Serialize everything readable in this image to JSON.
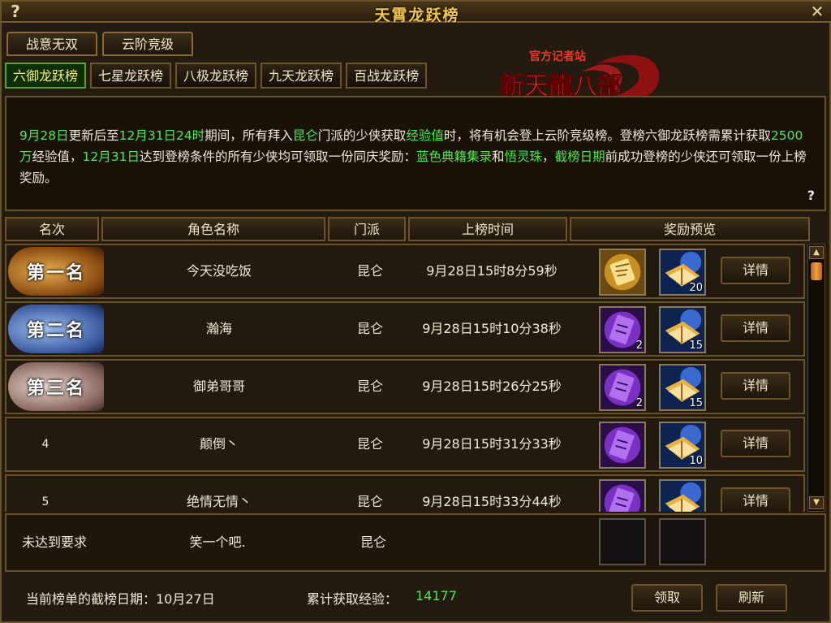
{
  "window": {
    "title": "天霄龙跃榜",
    "help_icon": "?",
    "close_icon": "✕"
  },
  "top_tabs": [
    {
      "label": "战意无双"
    },
    {
      "label": "云阶竞级"
    }
  ],
  "rank_tabs": [
    {
      "label": "六御龙跃榜",
      "active": true
    },
    {
      "label": "七星龙跃榜"
    },
    {
      "label": "八极龙跃榜"
    },
    {
      "label": "九天龙跃榜"
    },
    {
      "label": "百战龙跃榜"
    }
  ],
  "logo": {
    "lines": [
      "官方记者站",
      "新天龍八部"
    ]
  },
  "description": {
    "parts": [
      {
        "t": "9月28日",
        "g": true
      },
      {
        "t": "更新后至",
        "g": false
      },
      {
        "t": "12月31日24时",
        "g": true
      },
      {
        "t": "期间，所有拜入",
        "g": false
      },
      {
        "t": "昆仑",
        "g": true
      },
      {
        "t": "门派的少侠获取",
        "g": false
      },
      {
        "t": "经验值",
        "g": true
      },
      {
        "t": "时，将有机会登上云阶竞级榜。登榜六御龙跃榜需累计获取",
        "g": false
      },
      {
        "t": "2500万",
        "g": true
      },
      {
        "t": "经验值，",
        "g": false
      },
      {
        "t": "12月31日",
        "g": true
      },
      {
        "t": "达到登榜条件的所有少侠均可领取一份同庆奖励：",
        "g": false
      },
      {
        "t": "蓝色典籍集录",
        "g": true
      },
      {
        "t": "和",
        "g": false
      },
      {
        "t": "悟灵珠",
        "g": true
      },
      {
        "t": "，",
        "g": false
      },
      {
        "t": "截榜日期",
        "g": true
      },
      {
        "t": "前成功登榜的少侠还可领取一份上榜奖励。",
        "g": false
      }
    ]
  },
  "table": {
    "headers": [
      "名次",
      "角色名称",
      "门派",
      "上榜时间",
      "奖励预览"
    ],
    "detail_label": "详情",
    "rows": [
      {
        "rank": "第一名",
        "rank_style": "gold",
        "name": "今天没吃饭",
        "school": "昆仑",
        "time": "9月28日15时8分59秒",
        "reward1": {
          "icon": "gold-scroll-icon",
          "count": ""
        },
        "reward2": {
          "icon": "book-icon",
          "count": "20"
        }
      },
      {
        "rank": "第二名",
        "rank_style": "blue",
        "name": "瀚海",
        "school": "昆仑",
        "time": "9月28日15时10分38秒",
        "reward1": {
          "icon": "purple-scroll-icon",
          "count": "2"
        },
        "reward2": {
          "icon": "book-icon",
          "count": "15"
        }
      },
      {
        "rank": "第三名",
        "rank_style": "silver",
        "name": "御弟哥哥",
        "school": "昆仑",
        "time": "9月28日15时26分25秒",
        "reward1": {
          "icon": "purple-scroll-icon",
          "count": "2"
        },
        "reward2": {
          "icon": "book-icon",
          "count": "15"
        }
      },
      {
        "rank": "4",
        "rank_style": "plain",
        "name": "颠倒丶",
        "school": "昆仑",
        "time": "9月28日15时31分33秒",
        "reward1": {
          "icon": "purple-scroll-icon",
          "count": ""
        },
        "reward2": {
          "icon": "book-icon",
          "count": "10"
        }
      },
      {
        "rank": "5",
        "rank_style": "plain",
        "name": "绝情无情丶",
        "school": "昆仑",
        "time": "9月28日15时33分44秒",
        "reward1": {
          "icon": "purple-scroll-icon",
          "count": ""
        },
        "reward2": {
          "icon": "book-icon",
          "count": ""
        }
      }
    ]
  },
  "my_row": {
    "status": "未达到要求",
    "name": "笑一个吧.",
    "school": "昆仑"
  },
  "footer": {
    "deadline_label": "当前榜单的截榜日期：10月27日",
    "exp_label": "累计获取经验：",
    "exp_value": "14177",
    "claim_button": "领取",
    "refresh_button": "刷新"
  },
  "colors": {
    "highlight_green": "#4ee84e",
    "title_gold": "#f2c650",
    "active_tab_text": "#f8f070"
  }
}
